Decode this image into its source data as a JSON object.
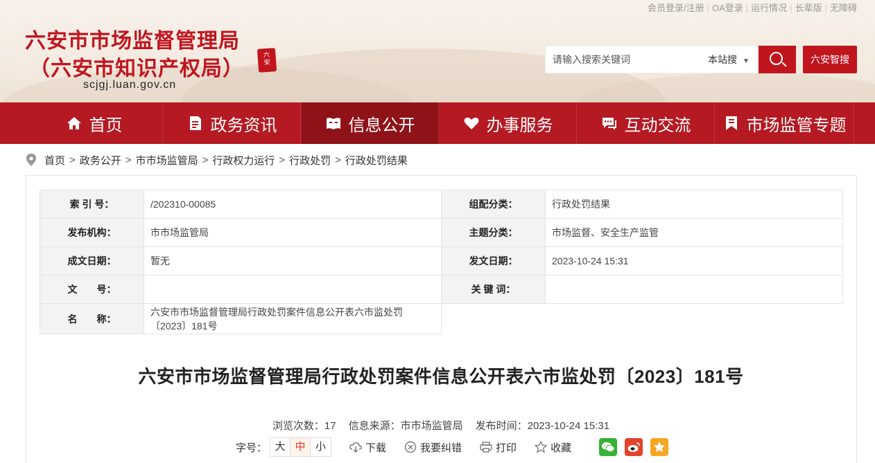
{
  "top_links": [
    "会员登录/注册",
    "OA登录",
    "运行情况",
    "长辈版",
    "无障碍"
  ],
  "site": {
    "title_line1": "六安市市场监督管理局",
    "title_line2": "（六安市知识产权局）",
    "domain": "scjgj.luan.gov.cn"
  },
  "search": {
    "placeholder": "请输入搜索关键词",
    "scope": "本站搜",
    "zhisou": "六安智搜"
  },
  "nav": [
    {
      "label": "首页",
      "icon": "home-icon"
    },
    {
      "label": "政务资讯",
      "icon": "document-icon"
    },
    {
      "label": "信息公开",
      "icon": "book-icon"
    },
    {
      "label": "办事服务",
      "icon": "heart-icon"
    },
    {
      "label": "互动交流",
      "icon": "chat-icon"
    },
    {
      "label": "市场监管专题",
      "icon": "bookmark-icon"
    }
  ],
  "breadcrumb": [
    "首页",
    "政务公开",
    "市市场监管局",
    "行政权力运行",
    "行政处罚",
    "行政处罚结果"
  ],
  "meta": {
    "rows": [
      {
        "l1": "索 引 号：",
        "v1": "/202310-00085",
        "l2": "组配分类：",
        "v2": "行政处罚结果"
      },
      {
        "l1": "发布机构：",
        "v1": "市市场监管局",
        "l2": "主题分类：",
        "v2": "市场监督、安全生产监管"
      },
      {
        "l1": "成文日期：",
        "v1": "暂无",
        "l2": "发文日期：",
        "v2": "2023-10-24 15:31"
      },
      {
        "l1": "文　　号：",
        "v1": "",
        "l2": "关 键 词：",
        "v2": ""
      }
    ],
    "name_label": "名　　称：",
    "name_value": "六安市市场监督管理局行政处罚案件信息公开表六市监处罚〔2023〕181号"
  },
  "doc": {
    "title": "六安市市场监督管理局行政处罚案件信息公开表六市监处罚〔2023〕181号",
    "views": "浏览次数：17",
    "source": "信息来源：市市场监管局",
    "publish_time": "发布时间：2023-10-24 15:31"
  },
  "tools": {
    "font_label": "字号：",
    "font_sizes": [
      "大",
      "中",
      "小"
    ],
    "active_font": "中",
    "download": "下载",
    "correct": "我要纠错",
    "print": "打印",
    "favorite": "收藏"
  },
  "colors": {
    "brand_red": "#c1151e",
    "nav_red": "#b51922",
    "nav_active": "#8e1218",
    "wechat": "#35b336",
    "weibo": "#e2432b",
    "qzone": "#f5a623"
  }
}
